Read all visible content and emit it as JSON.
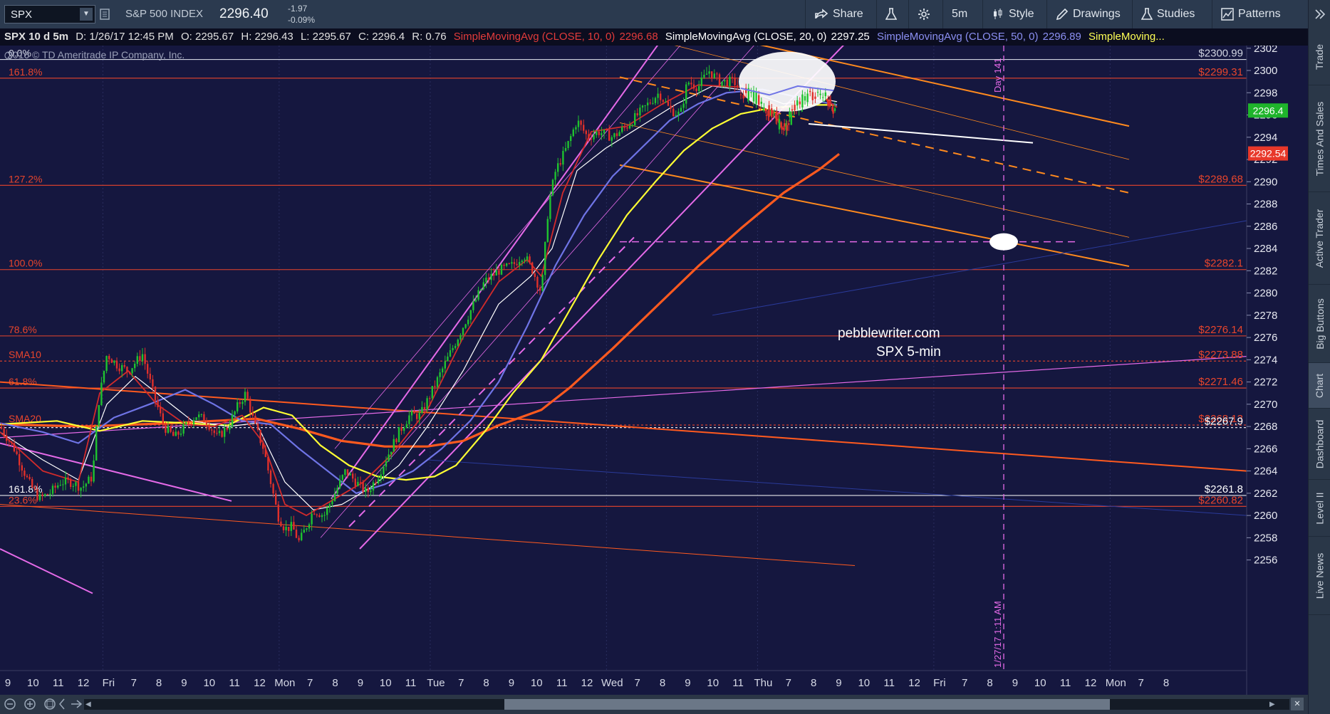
{
  "toolbar": {
    "symbol": "SPX",
    "index_name": "S&P 500 INDEX",
    "last_price": "2296.40",
    "change": "-1.97",
    "change_pct": "-0.09%",
    "share": "Share",
    "timeframe": "5m",
    "style": "Style",
    "drawings": "Drawings",
    "studies": "Studies",
    "patterns": "Patterns"
  },
  "infobar": {
    "title": "SPX 10 d 5m",
    "date": "D: 1/26/17 12:45 PM",
    "open": "O: 2295.67",
    "high": "H: 2296.43",
    "low": "L: 2295.67",
    "close": "C: 2296.4",
    "range": "R: 0.76",
    "sma10_label": "SimpleMovingAvg (CLOSE, 10, 0)",
    "sma10_value": "2296.68",
    "sma20_label": "SimpleMovingAvg (CLOSE, 20, 0)",
    "sma20_value": "2297.25",
    "sma50_label": "SimpleMovingAvg (CLOSE, 50, 0)",
    "sma50_value": "2296.89",
    "sma_more": "SimpleMoving..."
  },
  "copyright": "2016 © TD Ameritrade IP Company, Inc.",
  "annotations": {
    "watermark_line1": "pebblewriter.com",
    "watermark_line2": "SPX 5-min",
    "day_label": "Day 141",
    "date_label": "1/27/17 1:11 AM"
  },
  "side_tabs": [
    "Trade",
    "Times And Sales",
    "Active Trader",
    "Big Buttons",
    "Chart",
    "Dashboard",
    "Level II",
    "Live News"
  ],
  "side_tab_active": "Chart",
  "colors": {
    "background": "#15173f",
    "fib_line": "#e8452c",
    "sma10": "#d12b2b",
    "sma20": "#ffffff",
    "sma50": "#6f74e6",
    "sma100": "#ffff33",
    "sma200": "#ff5a1f",
    "channel_orange": "#ff8a1e",
    "channel_magenta": "#e56ae8"
  },
  "chart_data": {
    "type": "candlestick",
    "y_axis_ticks": [
      "2302",
      "2300",
      "2298",
      "2296",
      "2294",
      "2292",
      "2290",
      "2288",
      "2286",
      "2284",
      "2282",
      "2280",
      "2278",
      "2276",
      "2274",
      "2272",
      "2270",
      "2268",
      "2266",
      "2264",
      "2262",
      "2260",
      "2258",
      "2256"
    ],
    "ylim": [
      2255,
      2303
    ],
    "x_axis_labels": [
      "9",
      "10",
      "11",
      "12",
      "Fri",
      "7",
      "8",
      "9",
      "10",
      "11",
      "12",
      "Mon",
      "7",
      "8",
      "9",
      "10",
      "11",
      "Tue",
      "7",
      "8",
      "9",
      "10",
      "11",
      "12",
      "Wed",
      "7",
      "8",
      "9",
      "10",
      "11",
      "Thu",
      "7",
      "8",
      "9",
      "10",
      "11",
      "12",
      "Fri",
      "7",
      "8",
      "9",
      "10",
      "11",
      "12",
      "Mon",
      "7",
      "8"
    ],
    "price_tags": [
      {
        "text": "2296.4",
        "value": 2296.4,
        "bg": "#1fb52b",
        "fg": "#ffffff"
      },
      {
        "text": "2292.54",
        "value": 2292.54,
        "bg": "#e8382a",
        "fg": "#ffffff"
      }
    ],
    "fib_levels": [
      {
        "label": "0.0%",
        "value": 2300.99,
        "value_text": "$2300.99",
        "color": "#cfd3e0",
        "dashed": false
      },
      {
        "label": "161.8%",
        "value": 2299.31,
        "value_text": "$2299.31",
        "color": "#e8452c",
        "dashed": false
      },
      {
        "label": "127.2%",
        "value": 2289.68,
        "value_text": "$2289.68",
        "color": "#e8452c",
        "dashed": false
      },
      {
        "label": "100.0%",
        "value": 2282.1,
        "value_text": "$2282.1",
        "color": "#e8452c",
        "dashed": false
      },
      {
        "label": "78.6%",
        "value": 2276.14,
        "value_text": "$2276.14",
        "color": "#e8452c",
        "dashed": false
      },
      {
        "label": "SMA10",
        "value": 2273.88,
        "value_text": "$2273.88",
        "color": "#e8452c",
        "dashed": true
      },
      {
        "label": "61.8%",
        "value": 2271.46,
        "value_text": "$2271.46",
        "color": "#e8452c",
        "dashed": false
      },
      {
        "label": "SMA20",
        "value": 2268.13,
        "value_text": "$2268.13",
        "color": "#e8452c",
        "dashed": true
      },
      {
        "label": "",
        "value": 2267.9,
        "value_text": "$2267.9",
        "color": "#ffffff",
        "dashed": true
      },
      {
        "label": "161.8%",
        "value": 2261.8,
        "value_text": "$2261.8",
        "color": "#ffffff",
        "dashed": false
      },
      {
        "label": "23.6%",
        "value": 2260.82,
        "value_text": "$2260.82",
        "color": "#e8452c",
        "dashed": false
      }
    ],
    "price_path": [
      [
        0,
        2268
      ],
      [
        20,
        2266
      ],
      [
        40,
        2263
      ],
      [
        55,
        2261.5
      ],
      [
        70,
        2262
      ],
      [
        85,
        2263
      ],
      [
        100,
        2263
      ],
      [
        115,
        2262.5
      ],
      [
        130,
        2263.5
      ],
      [
        138,
        2270
      ],
      [
        150,
        2274.5
      ],
      [
        165,
        2273.5
      ],
      [
        180,
        2273
      ],
      [
        200,
        2274.5
      ],
      [
        215,
        2271
      ],
      [
        230,
        2268
      ],
      [
        245,
        2267
      ],
      [
        260,
        2268
      ],
      [
        275,
        2269
      ],
      [
        290,
        2268.5
      ],
      [
        305,
        2267
      ],
      [
        320,
        2268
      ],
      [
        335,
        2270
      ],
      [
        345,
        2271
      ],
      [
        358,
        2268
      ],
      [
        370,
        2266
      ],
      [
        380,
        2263
      ],
      [
        390,
        2260
      ],
      [
        400,
        2258.8
      ],
      [
        410,
        2259
      ],
      [
        420,
        2257.6
      ],
      [
        430,
        2259
      ],
      [
        440,
        2260.5
      ],
      [
        455,
        2260
      ],
      [
        470,
        2262
      ],
      [
        485,
        2264
      ],
      [
        500,
        2263
      ],
      [
        515,
        2262
      ],
      [
        530,
        2263.5
      ],
      [
        545,
        2265.5
      ],
      [
        560,
        2267.5
      ],
      [
        575,
        2269
      ],
      [
        590,
        2269
      ],
      [
        605,
        2271
      ],
      [
        620,
        2273
      ],
      [
        635,
        2275
      ],
      [
        650,
        2277
      ],
      [
        665,
        2279
      ],
      [
        680,
        2281
      ],
      [
        700,
        2282
      ],
      [
        720,
        2282.5
      ],
      [
        735,
        2283.5
      ],
      [
        748,
        2282
      ],
      [
        760,
        2280
      ],
      [
        770,
        2288
      ],
      [
        780,
        2291
      ],
      [
        795,
        2293
      ],
      [
        810,
        2295.5
      ],
      [
        825,
        2294
      ],
      [
        840,
        2294.5
      ],
      [
        860,
        2294
      ],
      [
        880,
        2295
      ],
      [
        895,
        2296
      ],
      [
        910,
        2297
      ],
      [
        925,
        2298
      ],
      [
        940,
        2296.5
      ],
      [
        955,
        2296
      ],
      [
        965,
        2299
      ],
      [
        980,
        2298.5
      ],
      [
        995,
        2300
      ],
      [
        1010,
        2299
      ],
      [
        1030,
        2299
      ],
      [
        1045,
        2298
      ],
      [
        1060,
        2297.5
      ],
      [
        1075,
        2296.5
      ],
      [
        1090,
        2296
      ],
      [
        1100,
        2294.5
      ],
      [
        1115,
        2296.5
      ],
      [
        1130,
        2297.5
      ],
      [
        1145,
        2298
      ],
      [
        1160,
        2297.3
      ],
      [
        1175,
        2296.4
      ]
    ],
    "sma10_path": [
      [
        0,
        2267.5
      ],
      [
        60,
        2264
      ],
      [
        110,
        2263
      ],
      [
        140,
        2271
      ],
      [
        180,
        2273
      ],
      [
        220,
        2270
      ],
      [
        260,
        2268.2
      ],
      [
        300,
        2268
      ],
      [
        340,
        2269
      ],
      [
        370,
        2266.5
      ],
      [
        400,
        2261
      ],
      [
        430,
        2260
      ],
      [
        470,
        2261.5
      ],
      [
        510,
        2263
      ],
      [
        550,
        2265.5
      ],
      [
        600,
        2269.5
      ],
      [
        650,
        2276
      ],
      [
        700,
        2281
      ],
      [
        740,
        2283
      ],
      [
        760,
        2281.5
      ],
      [
        790,
        2289
      ],
      [
        830,
        2294.5
      ],
      [
        880,
        2295
      ],
      [
        930,
        2297
      ],
      [
        980,
        2298.7
      ],
      [
        1040,
        2298.5
      ],
      [
        1100,
        2296.5
      ],
      [
        1150,
        2297.8
      ],
      [
        1175,
        2296.7
      ]
    ],
    "sma20_path": [
      [
        0,
        2267.5
      ],
      [
        60,
        2265
      ],
      [
        110,
        2263.2
      ],
      [
        150,
        2270
      ],
      [
        190,
        2272.5
      ],
      [
        230,
        2270.5
      ],
      [
        270,
        2268.5
      ],
      [
        320,
        2268
      ],
      [
        360,
        2268.3
      ],
      [
        400,
        2263
      ],
      [
        440,
        2260.5
      ],
      [
        480,
        2261
      ],
      [
        520,
        2262.5
      ],
      [
        560,
        2264.5
      ],
      [
        600,
        2268
      ],
      [
        650,
        2273
      ],
      [
        700,
        2279
      ],
      [
        745,
        2281.5
      ],
      [
        775,
        2284
      ],
      [
        810,
        2291
      ],
      [
        850,
        2293
      ],
      [
        900,
        2295
      ],
      [
        950,
        2297
      ],
      [
        1000,
        2298.6
      ],
      [
        1050,
        2298.2
      ],
      [
        1100,
        2297
      ],
      [
        1150,
        2297.5
      ],
      [
        1175,
        2297.2
      ]
    ],
    "sma50_path": [
      [
        0,
        2268.3
      ],
      [
        60,
        2267.5
      ],
      [
        110,
        2266.5
      ],
      [
        160,
        2268.8
      ],
      [
        210,
        2270
      ],
      [
        260,
        2271.3
      ],
      [
        300,
        2270
      ],
      [
        340,
        2268.5
      ],
      [
        380,
        2268.2
      ],
      [
        420,
        2266
      ],
      [
        460,
        2264
      ],
      [
        500,
        2262
      ],
      [
        540,
        2262.8
      ],
      [
        580,
        2264
      ],
      [
        620,
        2266
      ],
      [
        660,
        2268.5
      ],
      [
        700,
        2272
      ],
      [
        740,
        2277
      ],
      [
        780,
        2282.5
      ],
      [
        820,
        2287
      ],
      [
        860,
        2290.5
      ],
      [
        900,
        2293
      ],
      [
        940,
        2295.5
      ],
      [
        980,
        2297
      ],
      [
        1020,
        2298
      ],
      [
        1070,
        2298.3
      ],
      [
        1120,
        2297.6
      ],
      [
        1175,
        2296.9
      ]
    ],
    "sma100_path": [
      [
        0,
        2268.2
      ],
      [
        80,
        2268.5
      ],
      [
        140,
        2267.6
      ],
      [
        200,
        2268.5
      ],
      [
        260,
        2268.3
      ],
      [
        320,
        2268.1
      ],
      [
        370,
        2269.7
      ],
      [
        410,
        2269
      ],
      [
        450,
        2266.3
      ],
      [
        490,
        2264.5
      ],
      [
        530,
        2263.5
      ],
      [
        570,
        2263.2
      ],
      [
        610,
        2263.5
      ],
      [
        640,
        2264.5
      ],
      [
        680,
        2267.5
      ],
      [
        720,
        2271
      ],
      [
        760,
        2274
      ],
      [
        800,
        2278.5
      ],
      [
        840,
        2283
      ],
      [
        880,
        2287
      ],
      [
        920,
        2290
      ],
      [
        960,
        2292.8
      ],
      [
        1000,
        2294.8
      ],
      [
        1040,
        2296.1
      ],
      [
        1080,
        2296.6
      ],
      [
        1130,
        2296.9
      ],
      [
        1175,
        2296.9
      ]
    ],
    "sma200_path": [
      [
        0,
        2268.2
      ],
      [
        120,
        2268
      ],
      [
        240,
        2268.3
      ],
      [
        360,
        2268.7
      ],
      [
        420,
        2267.8
      ],
      [
        480,
        2266.7
      ],
      [
        540,
        2266.2
      ],
      [
        600,
        2266.2
      ],
      [
        650,
        2266.7
      ],
      [
        700,
        2268.1
      ],
      [
        760,
        2269.5
      ],
      [
        800,
        2271.5
      ],
      [
        860,
        2275
      ],
      [
        920,
        2278.7
      ],
      [
        980,
        2282.4
      ],
      [
        1040,
        2285.8
      ],
      [
        1100,
        2289
      ],
      [
        1150,
        2291.1
      ],
      [
        1178,
        2292.5
      ]
    ]
  }
}
